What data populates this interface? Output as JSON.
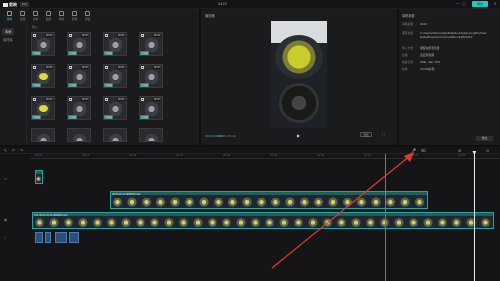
{
  "app": {
    "name": "剪映",
    "badge": "Pro",
    "title": "0422",
    "export_label": "导出",
    "window_controls": [
      "—",
      "□",
      "✕"
    ]
  },
  "media": {
    "tabs": [
      {
        "label": "媒体",
        "icon": "media-icon",
        "active": true
      },
      {
        "label": "音频",
        "icon": "audio-icon",
        "active": false
      },
      {
        "label": "文本",
        "icon": "text-icon",
        "active": false
      },
      {
        "label": "贴纸",
        "icon": "sticker-icon",
        "active": false
      },
      {
        "label": "特效",
        "icon": "effects-icon",
        "active": false
      },
      {
        "label": "转场",
        "icon": "transition-icon",
        "active": false
      },
      {
        "label": "滤镜",
        "icon": "filter-icon",
        "active": false
      }
    ],
    "side_items": [
      {
        "label": "本地",
        "active": true
      },
      {
        "label": "素材库",
        "active": false
      }
    ],
    "header": "导入",
    "thumbs": [
      {
        "dur": "00:03",
        "tag": "已添加",
        "egg": false
      },
      {
        "dur": "00:03",
        "tag": "已添加",
        "egg": false
      },
      {
        "dur": "00:04",
        "tag": "已添加",
        "egg": false
      },
      {
        "dur": "00:02",
        "tag": "已添加",
        "egg": false
      },
      {
        "dur": "00:05",
        "tag": "已添加",
        "egg": true
      },
      {
        "dur": "00:03",
        "tag": "已添加",
        "egg": false
      },
      {
        "dur": "00:04",
        "tag": "已添加",
        "egg": false
      },
      {
        "dur": "00:03",
        "tag": "已添加",
        "egg": false
      },
      {
        "dur": "00:02",
        "tag": "已添加",
        "egg": true
      },
      {
        "dur": "00:03",
        "tag": "已添加",
        "egg": false
      },
      {
        "dur": "00:04",
        "tag": "已添加",
        "egg": false
      },
      {
        "dur": "00:03",
        "tag": "已添加",
        "egg": false
      },
      {
        "dur": "",
        "tag": "",
        "egg": false
      },
      {
        "dur": "",
        "tag": "",
        "egg": false
      },
      {
        "dur": "",
        "tag": "",
        "egg": false
      },
      {
        "dur": "",
        "tag": "",
        "egg": false
      }
    ]
  },
  "player": {
    "title": "播放器",
    "time_current": "00:00:00:00",
    "time_total": "00:01:25:10",
    "ratio_label": "原始",
    "play_icon": "play-icon",
    "fullscreen_icon": "fullscreen-icon"
  },
  "properties": {
    "title": "草稿参数",
    "rows": [
      {
        "label": "草稿名称",
        "value": "0422"
      },
      {
        "label": "保存位置",
        "value": "C:/Users/Admin/AppData/Local/JianyingPro/User Data/Projects/com.lveditor.draft/0422"
      },
      {
        "label": "导入方式",
        "value": "保留在原有位置"
      },
      {
        "label": "比例",
        "value": "适应原视频"
      },
      {
        "label": "色彩空间",
        "value": "SDR - Rec.709"
      },
      {
        "label": "帧率",
        "value": "30.00帧/秒"
      }
    ],
    "edit_label": "修改"
  },
  "timeline": {
    "ticks": [
      "00:00",
      "00:10",
      "00:20",
      "00:30",
      "00:40",
      "00:50",
      "01:00",
      "01:10",
      "01:20",
      "01:30"
    ],
    "tools_left": [
      "↖",
      "↶",
      "↷"
    ],
    "tools_right": [
      "🎤",
      "⌧",
      "⊕",
      "⊖"
    ],
    "overlay_clip_label": "00:00:20:22 视频素材.mp4",
    "main_clip_label": "封面 00:01:25:10 视频素材.mp4"
  },
  "colors": {
    "accent": "#27c6c2",
    "clip": "#1e5f5c",
    "arrow": "#e03b2e"
  }
}
